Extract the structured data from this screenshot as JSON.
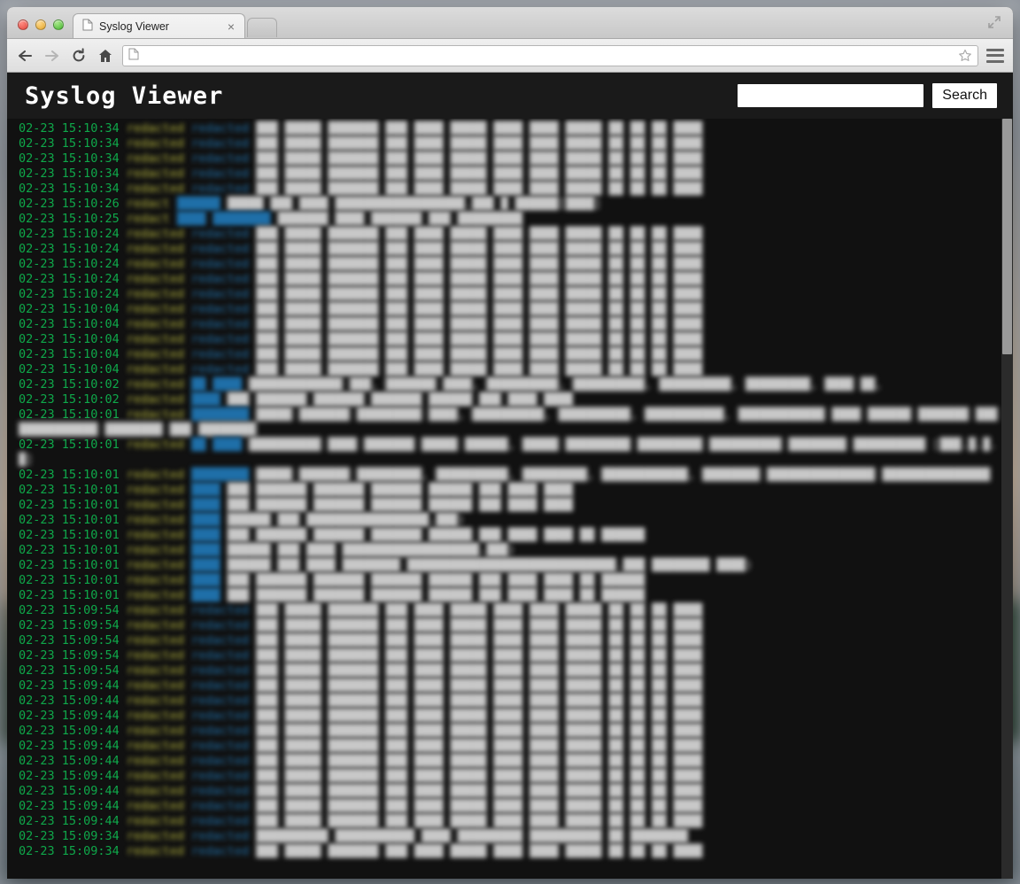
{
  "desktop": {
    "label": "desktop-wallpaper"
  },
  "browser": {
    "tab": {
      "title": "Syslog Viewer",
      "favicon": "document-icon",
      "close_label": "×",
      "new_tab_label": ""
    },
    "toolbar": {
      "back_label": "back-icon",
      "forward_label": "forward-icon",
      "reload_label": "reload-icon",
      "home_label": "home-icon",
      "url_value": "",
      "url_placeholder": "",
      "url_favicon": "document-icon",
      "bookmark_label": "star-icon",
      "menu_label": "hamburger-menu-icon"
    },
    "window_controls": {
      "close": "close-window-button",
      "minimize": "minimize-window-button",
      "zoom": "zoom-window-button",
      "expand": "fullscreen-expand-icon"
    }
  },
  "app": {
    "title": "Syslog Viewer",
    "search": {
      "value": "",
      "placeholder": "",
      "button_label": "Search"
    },
    "colors": {
      "header_bg": "#1a1a1a",
      "log_bg": "#111111",
      "timestamp": "#0fa84a",
      "hostname": "#b3b33c",
      "process": "#1f6fa8",
      "message": "#c8c8c8",
      "scrollbar_thumb": "#9a9a9a"
    },
    "scrollbar": {
      "thumb_top_pct": 0,
      "thumb_height_pct": 31
    }
  },
  "log": {
    "date": "02-23",
    "lines": [
      {
        "ts": "02-23 15:10:34",
        "host": "redacted",
        "proc": "redacted",
        "msg": "███ █████ ███████ ███ ████ █████ ████ ████ █████ ██ ██ ██ ████",
        "wrapped": false
      },
      {
        "ts": "02-23 15:10:34",
        "host": "redacted",
        "proc": "redacted",
        "msg": "███ █████ ███████ ███ ████ █████ ████ ████ █████ ██ ██ ██ ████",
        "wrapped": false
      },
      {
        "ts": "02-23 15:10:34",
        "host": "redacted",
        "proc": "redacted",
        "msg": "███ █████ ███████ ███ ████ █████ ████ ████ █████ ██ ██ ██ ████",
        "wrapped": false
      },
      {
        "ts": "02-23 15:10:34",
        "host": "redacted",
        "proc": "redacted",
        "msg": "███ █████ ███████ ███ ████ █████ ████ ████ █████ ██ ██ ██ ████",
        "wrapped": false
      },
      {
        "ts": "02-23 15:10:34",
        "host": "redacted",
        "proc": "redacted",
        "msg": "███ █████ ███████ ███ ████ █████ ████ ████ █████ ██ ██ ██ ████",
        "wrapped": false
      },
      {
        "ts": "02-23 15:10:26",
        "host": "redact",
        "proc": "██████",
        "msg": "█████ ███ ████ ██████████████████.███ █ ██████[████]",
        "wrapped": false
      },
      {
        "ts": "02-23 15:10:25",
        "host": "redact",
        "proc": "████ ████████",
        "msg": "███████ ████ ███████ ███ █████████",
        "wrapped": false
      },
      {
        "ts": "02-23 15:10:24",
        "host": "redacted",
        "proc": "redacted",
        "msg": "███ █████ ███████ ███ ████ █████ ████ ████ █████ ██ ██ ██ ████",
        "wrapped": false
      },
      {
        "ts": "02-23 15:10:24",
        "host": "redacted",
        "proc": "redacted",
        "msg": "███ █████ ███████ ███ ████ █████ ████ ████ █████ ██ ██ ██ ████",
        "wrapped": false
      },
      {
        "ts": "02-23 15:10:24",
        "host": "redacted",
        "proc": "redacted",
        "msg": "███ █████ ███████ ███ ████ █████ ████ ████ █████ ██ ██ ██ ████",
        "wrapped": false
      },
      {
        "ts": "02-23 15:10:24",
        "host": "redacted",
        "proc": "redacted",
        "msg": "███ █████ ███████ ███ ████ █████ ████ ████ █████ ██ ██ ██ ████",
        "wrapped": false
      },
      {
        "ts": "02-23 15:10:24",
        "host": "redacted",
        "proc": "redacted",
        "msg": "███ █████ ███████ ███ ████ █████ ████ ████ █████ ██ ██ ██ ████",
        "wrapped": false
      },
      {
        "ts": "02-23 15:10:04",
        "host": "redacted",
        "proc": "redacted",
        "msg": "███ █████ ███████ ███ ████ █████ ████ ████ █████ ██ ██ ██ ████",
        "wrapped": false
      },
      {
        "ts": "02-23 15:10:04",
        "host": "redacted",
        "proc": "redacted",
        "msg": "███ █████ ███████ ███ ████ █████ ████ ████ █████ ██ ██ ██ ████",
        "wrapped": false
      },
      {
        "ts": "02-23 15:10:04",
        "host": "redacted",
        "proc": "redacted",
        "msg": "███ █████ ███████ ███ ████ █████ ████ ████ █████ ██ ██ ██ ████",
        "wrapped": false
      },
      {
        "ts": "02-23 15:10:04",
        "host": "redacted",
        "proc": "redacted",
        "msg": "███ █████ ███████ ███ ████ █████ ████ ████ █████ ██ ██ ██ ████",
        "wrapped": false
      },
      {
        "ts": "02-23 15:10:04",
        "host": "redacted",
        "proc": "redacted",
        "msg": "███ █████ ███████ ███ ████ █████ ████ ████ █████ ██ ██ ██ ████",
        "wrapped": false
      },
      {
        "ts": "02-23 15:10:02",
        "host": "redacted",
        "proc": "██ ████",
        "msg": "█████████████ ███, ███████ ████, ██████████, ██████████, ██████████, █████████, ████ ██,",
        "wrapped": true
      },
      {
        "ts": "02-23 15:10:02",
        "host": "redacted",
        "proc": "████",
        "msg": "███ ███████ ███████ ███████ ██████ ███ ████ ████",
        "wrapped": false
      },
      {
        "ts": "02-23 15:10:01",
        "host": "redacted",
        "proc": "████████",
        "msg": "█████ ███████ █████████ ████, ██████████, ██████████, ███████████, ████████████ ████ ██████ ███████ ██████████████ ████████ ███ ████████",
        "wrapped": true
      },
      {
        "ts": "02-23 15:10:01",
        "host": "redacted",
        "proc": "██ ████",
        "msg": "██████████ ████ ███████ █████ ██████, █████ █████████ █████████ ██████████ ████████ ██████████ [███.█.█.█]",
        "wrapped": true
      },
      {
        "ts": "02-23 15:10:01",
        "host": "redacted",
        "proc": "████████",
        "msg": "█████ ███████ █████████, ██████████, █████████, ████████████, ████████ ███████████████ ███████████████",
        "wrapped": true
      },
      {
        "ts": "02-23 15:10:01",
        "host": "redacted",
        "proc": "████",
        "msg": "███ ███████ ███████ ███████ ██████ ███ ████ ████",
        "wrapped": false
      },
      {
        "ts": "02-23 15:10:01",
        "host": "redacted",
        "proc": "████",
        "msg": "███ ███████ ███████ ███████ ██████ ███ ████ ████",
        "wrapped": false
      },
      {
        "ts": "02-23 15:10:01",
        "host": "redacted",
        "proc": "████",
        "msg": "██████ ███ █████████████████.███)",
        "wrapped": false
      },
      {
        "ts": "02-23 15:10:01",
        "host": "redacted",
        "proc": "████",
        "msg": "███ ███████ ███████ ███████ ██████ ███ ████ ████ ██ ██████",
        "wrapped": false
      },
      {
        "ts": "02-23 15:10:01",
        "host": "redacted",
        "proc": "████",
        "msg": "██████ ███ ████ ███████████████████.███)",
        "wrapped": false
      },
      {
        "ts": "02-23 15:10:01",
        "host": "redacted",
        "proc": "████",
        "msg": "██████ ███ ████ ████████ █████████████████████████████.███ ████████ ████)",
        "wrapped": false
      },
      {
        "ts": "02-23 15:10:01",
        "host": "redacted",
        "proc": "████",
        "msg": "███ ███████ ███████ ███████ ██████ ███ ████ ████ ██ ██████",
        "wrapped": false
      },
      {
        "ts": "02-23 15:10:01",
        "host": "redacted",
        "proc": "████",
        "msg": "███ ███████ ███████ ███████ ██████ ███ ████ ████ ██ ██████",
        "wrapped": false
      },
      {
        "ts": "02-23 15:09:54",
        "host": "redacted",
        "proc": "redacted",
        "msg": "███ █████ ███████ ███ ████ █████ ████ ████ █████ ██ ██ ██ ████",
        "wrapped": false
      },
      {
        "ts": "02-23 15:09:54",
        "host": "redacted",
        "proc": "redacted",
        "msg": "███ █████ ███████ ███ ████ █████ ████ ████ █████ ██ ██ ██ ████",
        "wrapped": false
      },
      {
        "ts": "02-23 15:09:54",
        "host": "redacted",
        "proc": "redacted",
        "msg": "███ █████ ███████ ███ ████ █████ ████ ████ █████ ██ ██ ██ ████",
        "wrapped": false
      },
      {
        "ts": "02-23 15:09:54",
        "host": "redacted",
        "proc": "redacted",
        "msg": "███ █████ ███████ ███ ████ █████ ████ ████ █████ ██ ██ ██ ████",
        "wrapped": false
      },
      {
        "ts": "02-23 15:09:54",
        "host": "redacted",
        "proc": "redacted",
        "msg": "███ █████ ███████ ███ ████ █████ ████ ████ █████ ██ ██ ██ ████",
        "wrapped": false
      },
      {
        "ts": "02-23 15:09:44",
        "host": "redacted",
        "proc": "redacted",
        "msg": "███ █████ ███████ ███ ████ █████ ████ ████ █████ ██ ██ ██ ████",
        "wrapped": false
      },
      {
        "ts": "02-23 15:09:44",
        "host": "redacted",
        "proc": "redacted",
        "msg": "███ █████ ███████ ███ ████ █████ ████ ████ █████ ██ ██ ██ ████",
        "wrapped": false
      },
      {
        "ts": "02-23 15:09:44",
        "host": "redacted",
        "proc": "redacted",
        "msg": "███ █████ ███████ ███ ████ █████ ████ ████ █████ ██ ██ ██ ████",
        "wrapped": false
      },
      {
        "ts": "02-23 15:09:44",
        "host": "redacted",
        "proc": "redacted",
        "msg": "███ █████ ███████ ███ ████ █████ ████ ████ █████ ██ ██ ██ ████",
        "wrapped": false
      },
      {
        "ts": "02-23 15:09:44",
        "host": "redacted",
        "proc": "redacted",
        "msg": "███ █████ ███████ ███ ████ █████ ████ ████ █████ ██ ██ ██ ████",
        "wrapped": false
      },
      {
        "ts": "02-23 15:09:44",
        "host": "redacted",
        "proc": "redacted",
        "msg": "███ █████ ███████ ███ ████ █████ ████ ████ █████ ██ ██ ██ ████",
        "wrapped": false
      },
      {
        "ts": "02-23 15:09:44",
        "host": "redacted",
        "proc": "redacted",
        "msg": "███ █████ ███████ ███ ████ █████ ████ ████ █████ ██ ██ ██ ████",
        "wrapped": false
      },
      {
        "ts": "02-23 15:09:44",
        "host": "redacted",
        "proc": "redacted",
        "msg": "███ █████ ███████ ███ ████ █████ ████ ████ █████ ██ ██ ██ ████",
        "wrapped": false
      },
      {
        "ts": "02-23 15:09:44",
        "host": "redacted",
        "proc": "redacted",
        "msg": "███ █████ ███████ ███ ████ █████ ████ ████ █████ ██ ██ ██ ████",
        "wrapped": false
      },
      {
        "ts": "02-23 15:09:44",
        "host": "redacted",
        "proc": "redacted",
        "msg": "███ █████ ███████ ███ ████ █████ ████ ████ █████ ██ ██ ██ ████",
        "wrapped": false
      },
      {
        "ts": "02-23 15:09:34",
        "host": "redacted",
        "proc": "redacted",
        "msg": "██████████ ███████████ ████ █████████ ██████████ ██ ████████",
        "wrapped": false
      },
      {
        "ts": "02-23 15:09:34",
        "host": "redacted",
        "proc": "redacted",
        "msg": "███ █████ ███████ ███ ████ █████ ████ ████ █████ ██ ██ ██ ████",
        "wrapped": false
      }
    ]
  }
}
